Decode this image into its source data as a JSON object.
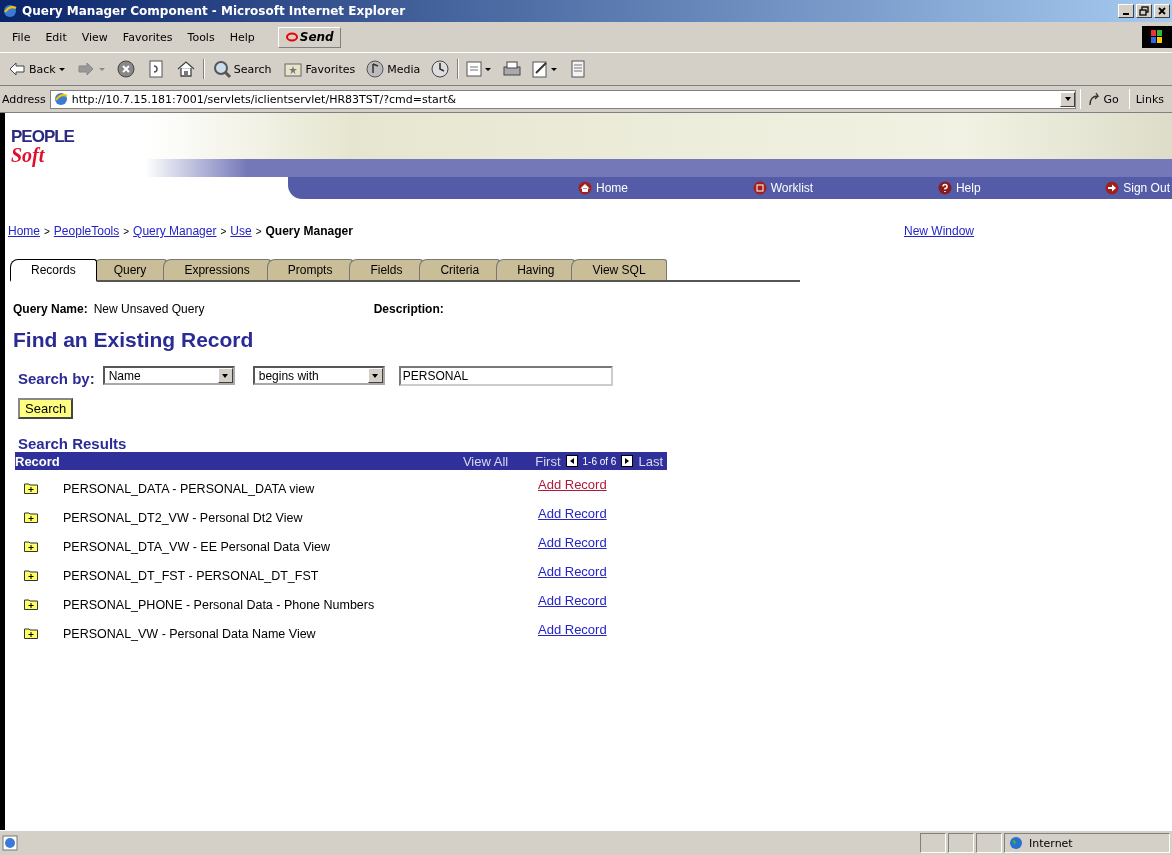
{
  "window": {
    "title": "Query Manager Component - Microsoft Internet Explorer"
  },
  "menu": [
    "File",
    "Edit",
    "View",
    "Favorites",
    "Tools",
    "Help"
  ],
  "send_button": "Send",
  "toolbar": [
    {
      "kind": "back",
      "label": "Back"
    },
    {
      "kind": "forward"
    },
    {
      "kind": "stop"
    },
    {
      "kind": "refresh"
    },
    {
      "kind": "home"
    },
    {
      "kind": "search",
      "label": "Search"
    },
    {
      "kind": "favorites",
      "label": "Favorites"
    },
    {
      "kind": "media",
      "label": "Media"
    },
    {
      "kind": "history"
    },
    {
      "kind": "mail"
    },
    {
      "kind": "print"
    },
    {
      "kind": "edit"
    },
    {
      "kind": "discuss"
    }
  ],
  "address": {
    "label": "Address",
    "value": "http://10.7.15.181:7001/servlets/iclientservlet/HR83TST/?cmd=start&",
    "go": "Go",
    "links": "Links"
  },
  "logo": {
    "top": "PEOPLE",
    "bottom": "Soft"
  },
  "header_nav": [
    {
      "kind": "home",
      "label": "Home"
    },
    {
      "kind": "worklist",
      "label": "Worklist"
    },
    {
      "kind": "help",
      "label": "Help"
    },
    {
      "kind": "signout",
      "label": "Sign Out"
    }
  ],
  "breadcrumb": [
    {
      "label": "Home",
      "link": true
    },
    {
      "label": "PeopleTools",
      "link": true
    },
    {
      "label": "Query Manager",
      "link": true
    },
    {
      "label": "Use",
      "link": true
    },
    {
      "label": "Query Manager",
      "link": false
    }
  ],
  "breadcrumb_separator": ">",
  "new_window": "New Window",
  "tabs": [
    {
      "label": "Records",
      "selected": true
    },
    {
      "label": "Query",
      "selected": false
    },
    {
      "label": "Expressions",
      "selected": false
    },
    {
      "label": "Prompts",
      "selected": false
    },
    {
      "label": "Fields",
      "selected": false
    },
    {
      "label": "Criteria",
      "selected": false
    },
    {
      "label": "Having",
      "selected": false
    },
    {
      "label": "View SQL",
      "selected": false
    }
  ],
  "query_name": {
    "label": "Query Name:",
    "value": "New Unsaved Query"
  },
  "description": {
    "label": "Description:"
  },
  "heading": "Find an Existing Record",
  "search": {
    "label": "Search by:",
    "field": "Name",
    "operator": "begins with",
    "value": "PERSONAL",
    "button": "Search"
  },
  "results": {
    "title": "Search Results",
    "column": "Record",
    "view_all": "View All",
    "first": "First",
    "range": "1-6 of 6",
    "last": "Last",
    "rows": [
      {
        "record": "PERSONAL_DATA - PERSONAL_DATA view",
        "action": "Add Record",
        "visited": true
      },
      {
        "record": "PERSONAL_DT2_VW - Personal Dt2 View",
        "action": "Add Record",
        "visited": false
      },
      {
        "record": "PERSONAL_DTA_VW - EE Personal Data View",
        "action": "Add Record",
        "visited": false
      },
      {
        "record": "PERSONAL_DT_FST - PERSONAL_DT_FST",
        "action": "Add Record",
        "visited": false
      },
      {
        "record": "PERSONAL_PHONE - Personal Data - Phone Numbers",
        "action": "Add Record",
        "visited": false
      },
      {
        "record": "PERSONAL_VW - Personal Data Name View",
        "action": "Add Record",
        "visited": false
      }
    ]
  },
  "status_bar": {
    "zone": "Internet"
  }
}
